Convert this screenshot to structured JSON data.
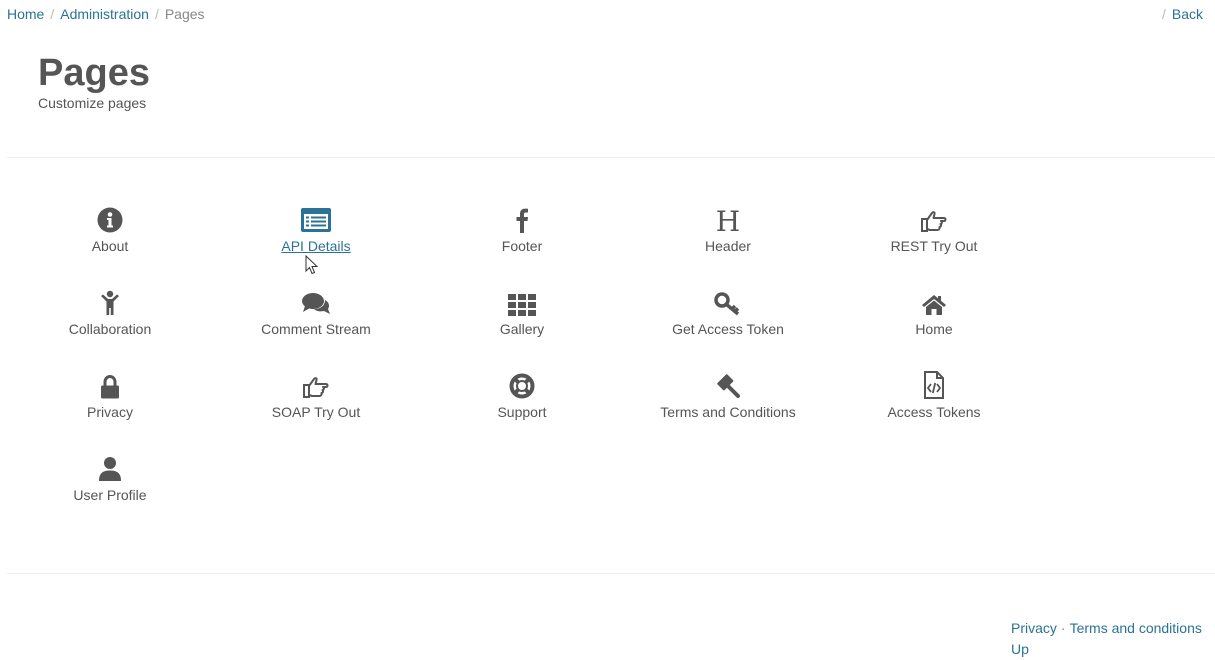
{
  "breadcrumb": {
    "home": "Home",
    "administration": "Administration",
    "current": "Pages",
    "separator": "/"
  },
  "back": {
    "separator": "/",
    "label": "Back"
  },
  "header": {
    "title": "Pages",
    "subtitle": "Customize pages"
  },
  "pages": [
    {
      "label": "About",
      "icon": "info-circle-icon"
    },
    {
      "label": "API Details",
      "icon": "list-alt-icon",
      "state": "hover"
    },
    {
      "label": "Footer",
      "icon": "facebook-icon"
    },
    {
      "label": "Header",
      "icon": "header-icon"
    },
    {
      "label": "REST Try Out",
      "icon": "hand-pointer-icon"
    },
    {
      "label": "Collaboration",
      "icon": "child-icon"
    },
    {
      "label": "Comment Stream",
      "icon": "comments-icon"
    },
    {
      "label": "Gallery",
      "icon": "th-grid-icon"
    },
    {
      "label": "Get Access Token",
      "icon": "key-icon"
    },
    {
      "label": "Home",
      "icon": "home-icon"
    },
    {
      "label": "Privacy",
      "icon": "lock-icon"
    },
    {
      "label": "SOAP Try Out",
      "icon": "hand-pointer-icon"
    },
    {
      "label": "Support",
      "icon": "life-ring-icon"
    },
    {
      "label": "Terms and Conditions",
      "icon": "gavel-icon"
    },
    {
      "label": "Access Tokens",
      "icon": "file-code-icon"
    },
    {
      "label": "User Profile",
      "icon": "user-icon"
    }
  ],
  "footer": {
    "privacy": "Privacy",
    "separator": "·",
    "terms": "Terms and conditions",
    "up": "Up"
  },
  "colors": {
    "link": "#2a7396",
    "text": "#555555",
    "divider": "#eeeeee"
  }
}
